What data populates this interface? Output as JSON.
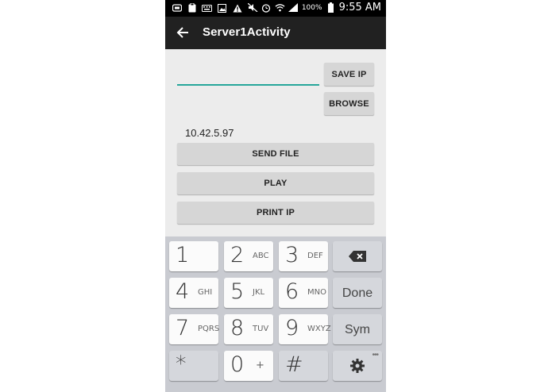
{
  "status_bar": {
    "battery_pct": "100%",
    "time": "9:55 AM",
    "icons": [
      "app-icon",
      "clipboard-icon",
      "keyboard-icon",
      "image-icon",
      "alert-icon",
      "mute-icon",
      "alarm-icon",
      "wifi-icon",
      "signal-icon",
      "battery-icon"
    ]
  },
  "appbar": {
    "title": "Server1Activity",
    "back_icon": "arrow-back-icon"
  },
  "form": {
    "ip_input_value": "",
    "save_ip_label": "SAVE IP",
    "browse_label": "BROWSE",
    "ip_text": "10.42.5.97",
    "send_file_label": "SEND FILE",
    "play_label": "PLAY",
    "print_ip_label": "PRINT IP",
    "accent_color": "#26a69a"
  },
  "keyboard": {
    "keys": [
      {
        "num": "1",
        "letters": ""
      },
      {
        "num": "2",
        "letters": "ABC"
      },
      {
        "num": "3",
        "letters": "DEF"
      },
      {
        "num": "4",
        "letters": "GHI"
      },
      {
        "num": "5",
        "letters": "JKL"
      },
      {
        "num": "6",
        "letters": "MNO"
      },
      {
        "num": "7",
        "letters": "PQRS"
      },
      {
        "num": "8",
        "letters": "TUV"
      },
      {
        "num": "9",
        "letters": "WXYZ"
      },
      {
        "num": "*",
        "letters": ""
      },
      {
        "num": "0",
        "letters": "+"
      },
      {
        "num": "#",
        "letters": ""
      }
    ],
    "done_label": "Done",
    "sym_label": "Sym",
    "backspace_icon": "backspace-icon",
    "settings_icon": "gear-icon"
  }
}
